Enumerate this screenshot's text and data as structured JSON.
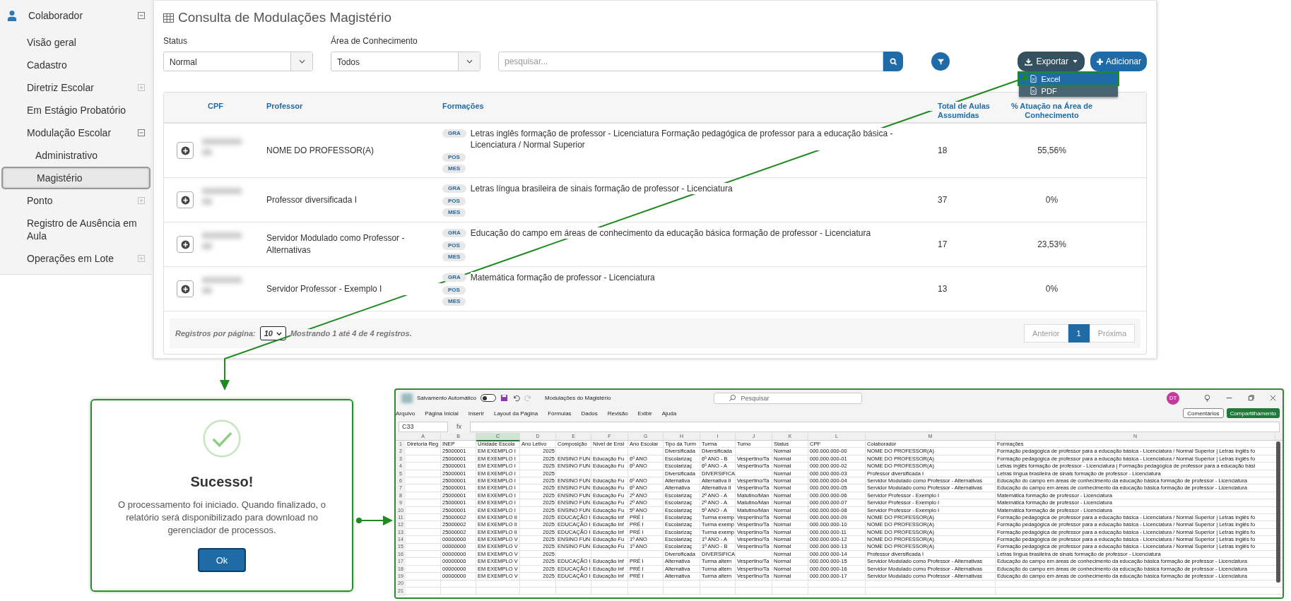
{
  "sidebar": {
    "title": "Colaborador",
    "expanded": true,
    "items": [
      {
        "label": "Visão geral",
        "kind": "link",
        "selected": false
      },
      {
        "label": "Cadastro",
        "kind": "link",
        "selected": false
      },
      {
        "label": "Diretriz Escolar",
        "kind": "group",
        "expanded": false,
        "selected": false
      },
      {
        "label": "Em Estágio Probatório",
        "kind": "link",
        "selected": false
      },
      {
        "label": "Modulação Escolar",
        "kind": "group",
        "expanded": true,
        "selected": false,
        "children": [
          {
            "label": "Administrativo",
            "selected": false
          },
          {
            "label": "Magistério",
            "selected": true
          }
        ]
      },
      {
        "label": "Ponto",
        "kind": "group",
        "expanded": false,
        "selected": false
      },
      {
        "label": "Registro de Ausência em Aula",
        "kind": "link",
        "selected": false
      },
      {
        "label": "Operações em Lote",
        "kind": "group",
        "expanded": false,
        "selected": false
      }
    ]
  },
  "page": {
    "title": "Consulta de Modulações Magistério",
    "filters": [
      {
        "label": "Status",
        "value": "Normal"
      },
      {
        "label": "Área de Conhecimento",
        "value": "Todos"
      }
    ],
    "search": {
      "placeholder": "pesquisar..."
    },
    "export_button": "Exportar",
    "add_button": "Adicionar",
    "export_menu": [
      {
        "label": "Excel",
        "selected": true
      },
      {
        "label": "PDF",
        "selected": false
      }
    ],
    "table": {
      "columns": [
        "CPF",
        "Professor",
        "Formações",
        "Total de Aulas Assumidas",
        "% Atuação na Área de Conhecimento"
      ],
      "rows": [
        {
          "professor": "NOME DO PROFESSOR(A)",
          "formacoes": [
            {
              "tag": "GRA",
              "text": "Letras inglês formação de professor - Licenciatura Formação pedagógica de professor para a educação básica - Licenciatura / Normal Superior"
            },
            {
              "tag": "POS"
            },
            {
              "tag": "MES"
            }
          ],
          "total": "18",
          "percent": "55,56%"
        },
        {
          "professor": "Professor diversificada I",
          "formacoes": [
            {
              "tag": "GRA",
              "text": "Letras língua brasileira de sinais formação de professor - Licenciatura"
            },
            {
              "tag": "POS"
            },
            {
              "tag": "MES"
            }
          ],
          "total": "37",
          "percent": "0%"
        },
        {
          "professor": "Servidor Modulado como Professor - Alternativas",
          "formacoes": [
            {
              "tag": "GRA",
              "text": "Educação do campo em áreas de conhecimento da educação básica formação de professor - Licenciatura"
            },
            {
              "tag": "POS"
            },
            {
              "tag": "MES"
            }
          ],
          "total": "17",
          "percent": "23,53%"
        },
        {
          "professor": "Servidor Professor - Exemplo I",
          "formacoes": [
            {
              "tag": "GRA",
              "text": "Matemática formação de professor - Licenciatura"
            },
            {
              "tag": "POS"
            },
            {
              "tag": "MES"
            }
          ],
          "total": "13",
          "percent": "0%"
        }
      ]
    },
    "footer": {
      "per_page_label": "Registros por página:",
      "per_page": "10",
      "summary": "Mostrando **1** até **4** de **4** registros."
    },
    "pagination": [
      {
        "label": "Anterior",
        "selected": false
      },
      {
        "label": "1",
        "selected": true
      },
      {
        "label": "Próxima",
        "selected": false
      }
    ]
  },
  "dialog": {
    "title": "Sucesso!",
    "message": "O processamento foi iniciado. Quando finalizado, o relatório será disponibilizado para download no gerenciador de processos.",
    "button": "Ok"
  },
  "excel": {
    "autosave_label": "Salvamento Automático",
    "autosave_on": false,
    "file_name": "Modulações do Magistério",
    "search": {
      "placeholder": "Pesquisar"
    },
    "avatar": "DT",
    "ribbon_tabs": [
      "Arquivo",
      "Página Inicial",
      "Inserir",
      "Layout da Página",
      "Fórmulas",
      "Dados",
      "Revisão",
      "Exibir",
      "Ajuda"
    ],
    "comments_button": "Comentários",
    "share_button": "Compartilhamento",
    "name_box": "C33",
    "formula_label": "fx",
    "columns": [
      {
        "letter": "A",
        "selected": false
      },
      {
        "letter": "B",
        "selected": false
      },
      {
        "letter": "C",
        "selected": true
      },
      {
        "letter": "D",
        "selected": false
      },
      {
        "letter": "E",
        "selected": false
      },
      {
        "letter": "F",
        "selected": false
      },
      {
        "letter": "G",
        "selected": false
      },
      {
        "letter": "H",
        "selected": false
      },
      {
        "letter": "I",
        "selected": false
      },
      {
        "letter": "J",
        "selected": false
      },
      {
        "letter": "K",
        "selected": false
      },
      {
        "letter": "L",
        "selected": false
      },
      {
        "letter": "M",
        "selected": false
      },
      {
        "letter": "N",
        "selected": false
      }
    ],
    "rows": [
      {
        "n": "1",
        "cells": {
          "A": "Diretoria Reg",
          "B": "INEP",
          "C": "Unidade Escola",
          "D": "Ano Letivo",
          "E": "Composição",
          "F": "Nível de Ensi",
          "G": "Ano Escolar",
          "H": "Tipo da Turm",
          "I": "Turma",
          "J": "Turno",
          "K": "Status",
          "L": "CPF",
          "M": "Colaborador",
          "N": "Formações"
        }
      },
      {
        "n": "2",
        "cells": {
          "B": "25000001",
          "C": "EM EXEMPLO I",
          "D": "2025",
          "H": "Diversificada",
          "I": "Diversificada",
          "K": "Normal",
          "L": "000.000.000-00",
          "M": "NOME DO PROFESSOR(A)",
          "N": "Formação pedagógica de professor para a educação básica - Licenciatura / Normal Superior | Letras inglês fo"
        }
      },
      {
        "n": "3",
        "cells": {
          "B": "25000001",
          "C": "EM EXEMPLO I",
          "D": "2025",
          "E": "ENSINO FUN",
          "F": "Educação Fu",
          "G": "6º ANO",
          "H": "Escolarizaç",
          "I": "6º ANO - B",
          "J": "Vespertino/Ta",
          "K": "Normal",
          "L": "000.000.000-01",
          "M": "NOME DO PROFESSOR(A)",
          "N": "Formação pedagógica de professor para a educação básica - Licenciatura / Normal Superior | Letras inglês fo"
        }
      },
      {
        "n": "4",
        "cells": {
          "B": "25000001",
          "C": "EM EXEMPLO I",
          "D": "2025",
          "E": "ENSINO FUN",
          "F": "Educação Fu",
          "G": "6º ANO",
          "H": "Escolarizaç",
          "I": "6º ANO - A",
          "J": "Vespertino/Ta",
          "K": "Normal",
          "L": "000.000.000-02",
          "M": "NOME DO PROFESSOR(A)",
          "N": "Letras inglês formação de professor - Licenciatura | Formação pedagógica de professor para a educação bási"
        }
      },
      {
        "n": "5",
        "cells": {
          "B": "25000001",
          "C": "EM EXEMPLO I",
          "D": "2025",
          "H": "Diversificada",
          "I": "DIVERSIFICA",
          "K": "Normal",
          "L": "000.000.000-03",
          "M": "Professor diversificada I",
          "N": "Letras língua brasileira de sinais formação de professor - Licenciatura"
        }
      },
      {
        "n": "6",
        "cells": {
          "B": "25000001",
          "C": "EM EXEMPLO I",
          "D": "2025",
          "E": "ENSINO FUN",
          "F": "Educação Fu",
          "G": "6º ANO",
          "H": "Alternativa",
          "I": "Alternativa II",
          "J": "Vespertino/Ta",
          "K": "Normal",
          "L": "000.000.000-04",
          "M": "Servidor Modulado como Professor - Alternativas",
          "N": "Educação do campo em áreas de conhecimento da educação básica formação de professor - Licenciatura"
        }
      },
      {
        "n": "7",
        "cells": {
          "B": "25000001",
          "C": "EM EXEMPLO I",
          "D": "2025",
          "E": "ENSINO FUN",
          "F": "Educação Fu",
          "G": "6º ANO",
          "H": "Alternativa",
          "I": "Alternativa II",
          "J": "Vespertino/Ta",
          "K": "Normal",
          "L": "000.000.000-05",
          "M": "Servidor Modulado como Professor - Alternativas",
          "N": "Educação do campo em áreas de conhecimento da educação básica formação de professor - Licenciatura"
        }
      },
      {
        "n": "8",
        "cells": {
          "B": "25000001",
          "C": "EM EXEMPLO I",
          "D": "2025",
          "E": "ENSINO FUN",
          "F": "Educação Fu",
          "G": "2º ANO",
          "H": "Escolarizaç",
          "I": "2º ANO - A",
          "J": "Matutino/Man",
          "K": "Normal",
          "L": "000.000.000-06",
          "M": "Servidor Professor - Exemplo I",
          "N": "Matemática formação de professor - Licenciatura"
        }
      },
      {
        "n": "9",
        "cells": {
          "B": "25000001",
          "C": "EM EXEMPLO I",
          "D": "2025",
          "E": "ENSINO FUN",
          "F": "Educação Fu",
          "G": "2º ANO",
          "H": "Escolarizaç",
          "I": "2º ANO - A",
          "J": "Matutino/Man",
          "K": "Normal",
          "L": "000.000.000-07",
          "M": "Servidor Professor - Exemplo I",
          "N": "Matemática formação de professor - Licenciatura"
        }
      },
      {
        "n": "10",
        "cells": {
          "B": "25000001",
          "C": "EM EXEMPLO I",
          "D": "2025",
          "E": "ENSINO FUN",
          "F": "Educação Fu",
          "G": "5º ANO",
          "H": "Escolarizaç",
          "I": "5º ANO - A",
          "J": "Matutino/Man",
          "K": "Normal",
          "L": "000.000.000-08",
          "M": "Servidor Professor - Exemplo I",
          "N": "Matemática formação de professor - Licenciatura"
        }
      },
      {
        "n": "11",
        "cells": {
          "B": "25000002",
          "C": "EM EXEMPLO II",
          "D": "2025",
          "E": "EDUCAÇÃO I",
          "F": "Educação Inf",
          "G": "PRÉ I",
          "H": "Escolarizaç",
          "I": "Turma exemp",
          "J": "Vespertino/Ta",
          "K": "Normal",
          "L": "000.000.000-09",
          "M": "NOME DO PROFESSOR(A)",
          "N": "Formação pedagógica de professor para a educação básica - Licenciatura / Normal Superior | Letras inglês fo"
        }
      },
      {
        "n": "12",
        "cells": {
          "B": "25000002",
          "C": "EM EXEMPLO II",
          "D": "2025",
          "E": "EDUCAÇÃO I",
          "F": "Educação Inf",
          "G": "PRÉ I",
          "H": "Escolarizaç",
          "I": "Turma exemp",
          "J": "Vespertino/Ta",
          "K": "Normal",
          "L": "000.000.000-10",
          "M": "NOME DO PROFESSOR(A)",
          "N": "Formação pedagógica de professor para a educação básica - Licenciatura / Normal Superior | Letras inglês fo"
        }
      },
      {
        "n": "13",
        "cells": {
          "B": "25000002",
          "C": "EM EXEMPLO II",
          "D": "2025",
          "E": "EDUCAÇÃO I",
          "F": "Educação Inf",
          "G": "PRÉ I",
          "H": "Escolarizaç",
          "I": "Turma exemp",
          "J": "Vespertino/Ta",
          "K": "Normal",
          "L": "000.000.000-11",
          "M": "NOME DO PROFESSOR(A)",
          "N": "Formação pedagógica de professor para a educação básica - Licenciatura / Normal Superior | Letras inglês fo"
        }
      },
      {
        "n": "14",
        "cells": {
          "B": "00000000",
          "C": "EM EXEMPLO V",
          "D": "2025",
          "E": "ENSINO FUN",
          "F": "Educação Fu",
          "G": "1º ANO",
          "H": "Escolarizaç",
          "I": "1º ANO - A",
          "J": "Vespertino/Ta",
          "K": "Normal",
          "L": "000.000.000-12",
          "M": "NOME DO PROFESSOR(A)",
          "N": "Formação pedagógica de professor para a educação básica - Licenciatura / Normal Superior | Letras inglês fo"
        }
      },
      {
        "n": "15",
        "cells": {
          "B": "00000000",
          "C": "EM EXEMPLO V",
          "D": "2025",
          "E": "ENSINO FUN",
          "F": "Educação Fu",
          "G": "1º ANO",
          "H": "Escolarizaç",
          "I": "1º ANO - B",
          "J": "Vespertino/Ta",
          "K": "Normal",
          "L": "000.000.000-13",
          "M": "NOME DO PROFESSOR(A)",
          "N": "Formação pedagógica de professor para a educação básica - Licenciatura / Normal Superior | Letras inglês fo"
        }
      },
      {
        "n": "16",
        "cells": {
          "B": "00000000",
          "C": "EM EXEMPLO V",
          "D": "2025",
          "H": "Diversificada",
          "I": "DIVERSIFICA",
          "K": "Normal",
          "L": "000.000.000-14",
          "M": "Professor diversificada I",
          "N": "Letras língua brasileira de sinais formação de professor - Licenciatura"
        }
      },
      {
        "n": "17",
        "cells": {
          "B": "00000000",
          "C": "EM EXEMPLO V",
          "D": "2025",
          "E": "EDUCAÇÃO I",
          "F": "Educação Inf",
          "G": "PRÉ I",
          "H": "Alternativa",
          "I": "Turma altern",
          "J": "Vespertino/Ta",
          "K": "Normal",
          "L": "000.000.000-15",
          "M": "Servidor Modulado como Professor - Alternativas",
          "N": "Educação do campo em áreas de conhecimento da educação básica formação de professor - Licenciatura"
        }
      },
      {
        "n": "18",
        "cells": {
          "B": "00000000",
          "C": "EM EXEMPLO V",
          "D": "2025",
          "E": "EDUCAÇÃO I",
          "F": "Educação Inf",
          "G": "PRÉ I",
          "H": "Alternativa",
          "I": "Turma altern",
          "J": "Vespertino/Ta",
          "K": "Normal",
          "L": "000.000.000-16",
          "M": "Servidor Modulado como Professor - Alternativas",
          "N": "Educação do campo em áreas de conhecimento da educação básica formação de professor - Licenciatura"
        }
      },
      {
        "n": "19",
        "cells": {
          "B": "00000000",
          "C": "EM EXEMPLO V",
          "D": "2025",
          "E": "EDUCAÇÃO I",
          "F": "Educação Inf",
          "G": "PRÉ I",
          "H": "Alternativa",
          "I": "Turma altern",
          "J": "Vespertino/Ta",
          "K": "Normal",
          "L": "000.000.000-17",
          "M": "Servidor Modulado como Professor - Alternativas",
          "N": "Educação do campo em áreas de conhecimento da educação básica formação de professor - Licenciatura"
        }
      },
      {
        "n": "20",
        "cells": {}
      },
      {
        "n": "21",
        "cells": {}
      }
    ]
  }
}
